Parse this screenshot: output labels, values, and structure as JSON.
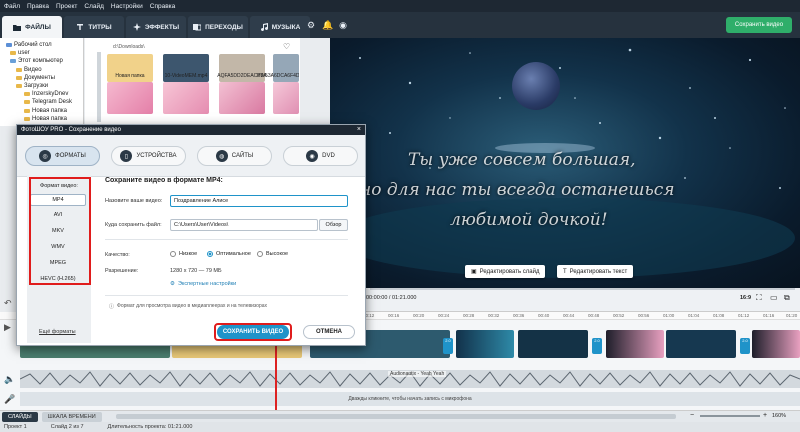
{
  "menubar": {
    "items": [
      "Файл",
      "Правка",
      "Проект",
      "Слайд",
      "Настройки",
      "Справка"
    ]
  },
  "toptabs": [
    {
      "label": "ФАЙЛЫ",
      "icon": "folder-icon"
    },
    {
      "label": "ТИТРЫ",
      "icon": "text-icon"
    },
    {
      "label": "ЭФФЕКТЫ",
      "icon": "sparkle-icon"
    },
    {
      "label": "ПЕРЕХОДЫ",
      "icon": "transition-icon"
    },
    {
      "label": "МУЗЫКА",
      "icon": "music-icon"
    }
  ],
  "save_top_label": "Сохранить видео",
  "filetree": {
    "items": [
      "Рабочий стол",
      "user",
      "Этот компьютер",
      "Видео",
      "Документы",
      "Загрузки",
      "InzerskyDnev",
      "Telegram Desk",
      "Новая папка",
      "Новая папка"
    ]
  },
  "thumbs": {
    "path": "d:\\Downloads\\",
    "labels": [
      "Новая папка",
      "10-VideoMEM.mp4",
      "AQFA5DD2DEACB5A",
      "PW53A6DCA6F4D2"
    ]
  },
  "preview": {
    "caption_lines": [
      "Ты уже совсем большая,",
      "но для нас ты всегда останешься",
      "любимой дочкой!"
    ],
    "edit_slide": "Редактировать слайд",
    "edit_text": "Редактировать текст",
    "time": "00:00:00 / 01:21.000",
    "aspect": "16:9"
  },
  "dialog": {
    "title": "ФотоШОУ PRO - Сохранение видео",
    "close_glyph": "×",
    "tabs": [
      "ФОРМАТЫ",
      "УСТРОЙСТВА",
      "САЙТЫ",
      "DVD"
    ],
    "format_heading": "Формат видео:",
    "formats": [
      "MP4",
      "AVI",
      "MKV",
      "WMV",
      "MPEG",
      "HEVC (H.265)"
    ],
    "more_formats": "Ещё форматы",
    "save_heading": "Сохраните видео в формате MP4:",
    "name_label": "Назовите ваше видео:",
    "name_value": "Поздравление Алисе",
    "path_label": "Куда сохранить файл:",
    "path_value": "C:\\Users\\User\\Videos\\",
    "browse": "Обзор",
    "quality_label": "Качество:",
    "quality_options": [
      "Низкое",
      "Оптимальное",
      "Высокое"
    ],
    "resolution_label": "Разрешение:",
    "resolution_value": "1280 x 720 — 79 МБ",
    "expert": "Экспертные настройки",
    "hint": "Формат для просмотра видео в медиаплеерах и на телевизорах",
    "save_button": "СОХРАНИТЬ ВИДЕО",
    "cancel_button": "ОТМЕНА"
  },
  "timeline": {
    "ruler": [
      "00:12",
      "00:16",
      "00:20",
      "00:24",
      "00:28",
      "00:32",
      "00:36",
      "00:40",
      "00:44",
      "00:48",
      "00:52",
      "00:56",
      "01:00",
      "01:04",
      "01:08",
      "01:12",
      "01:16",
      "01:20"
    ],
    "marker_values": [
      "2.0",
      "2.0",
      "2.0"
    ],
    "audio_label": "Audionautix - Yeah Yeah",
    "mic_hint": "Дважды кликните, чтобы начать запись с микрофона"
  },
  "bottom_tabs": [
    "СЛАЙДЫ",
    "ШКАЛА ВРЕМЕНИ"
  ],
  "zoom": "160%",
  "status": {
    "project": "Проект 1",
    "slide": "Слайд 2 из 7",
    "duration": "Длительность проекта: 01:21.000"
  }
}
